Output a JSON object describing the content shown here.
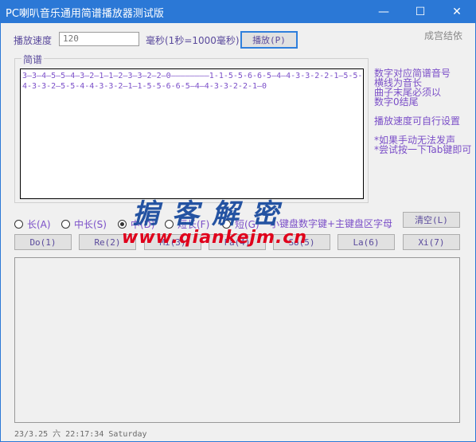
{
  "window": {
    "title": "PC喇叭音乐通用简谱播放器测试版",
    "minimize_glyph": "—",
    "maximize_glyph": "☐",
    "close_glyph": "✕"
  },
  "speed": {
    "label": "播放速度",
    "value": "120",
    "unit_label": "毫秒(1秒=1000毫秒)",
    "play_button": "播放(P)"
  },
  "author": "成宫结依",
  "score": {
    "legend": "简谱",
    "text": "3—3—4—5—5—4—3—2—1—1—2—3—3—2—2—0————————1-1-5-5-6-6-5—4—4-3-3-2-2-1—5-5-4-3-3-2—5-5-4-4-3-3-2—1—1-5-5-6-6-5—4—4-3-3-2-2-1—0"
  },
  "help": {
    "line1": "数字对应简谱音号",
    "line2": "横线为音长",
    "line3": "曲子末尾必须以",
    "line4": "数字0结尾",
    "line5": "播放速度可自行设置",
    "line6": "*如果手动无法发声",
    "line7": "*尝试按一下Tab键即可"
  },
  "durations": {
    "long": "长(A)",
    "mid_long": "中长(S)",
    "mid": "中(D)",
    "short_long": "短长(F)",
    "short": "短(G)",
    "selected": "mid",
    "hint": "小键盘数字键+主键盘区字母",
    "clear_button": "清空(L)"
  },
  "notes": {
    "do": "Do(1)",
    "re": "Re(2)",
    "mi": "Mi(3)",
    "fa": "Fa(4)",
    "sol": "So(5)",
    "la": "La(6)",
    "xi": "Xi(7)"
  },
  "status": "23/3.25 六 22:17:34  Saturday",
  "watermark": {
    "cn": "掮客解密",
    "url": "www.qiankejm.cn"
  }
}
